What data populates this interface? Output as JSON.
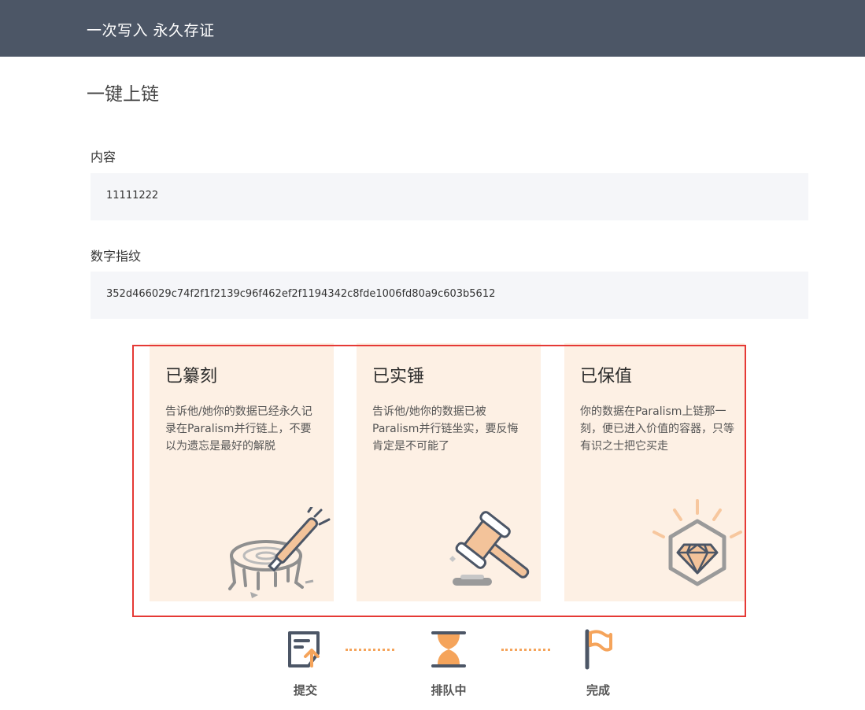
{
  "header": {
    "title": "一次写入 永久存证"
  },
  "page": {
    "title": "一键上链"
  },
  "fields": {
    "content": {
      "label": "内容",
      "value": "11111222"
    },
    "fingerprint": {
      "label": "数字指纹",
      "value": "352d466029c74f2f1f2139c96f462ef2f1194342c8fde1006fd80a9c603b5612"
    }
  },
  "cards": [
    {
      "title": "已纂刻",
      "desc": "告诉他/她你的数据已经永久记录在Paralism并行链上，不要以为遗忘是最好的解脱",
      "icon": "stump-chisel-icon"
    },
    {
      "title": "已实锤",
      "desc": "告诉他/她你的数据已被Paralism并行链坐实，要反悔肯定是不可能了",
      "icon": "gavel-icon"
    },
    {
      "title": "已保值",
      "desc": "你的数据在Paralism上链那一刻，便已进入价值的容器，只等有识之士把它买走",
      "icon": "diamond-icon"
    }
  ],
  "steps": [
    {
      "label": "提交",
      "icon": "submit-icon"
    },
    {
      "label": "排队中",
      "icon": "hourglass-icon"
    },
    {
      "label": "完成",
      "icon": "flag-icon"
    }
  ],
  "colors": {
    "topbar": "#4c5666",
    "card_bg": "#fdf0e4",
    "accent": "#f5a45b",
    "frame": "#e53935",
    "field_bg": "#f5f6f9"
  }
}
